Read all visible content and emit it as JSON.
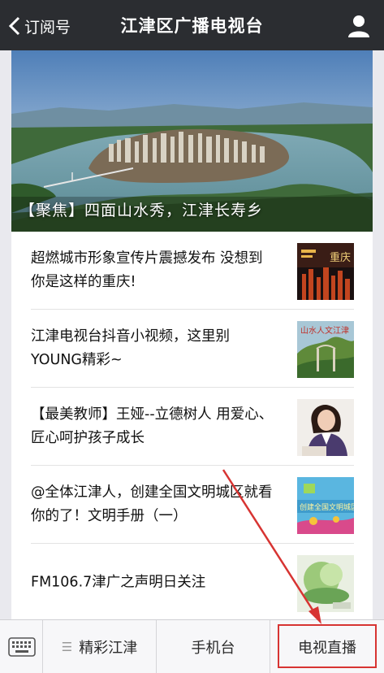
{
  "header": {
    "back_label": "订阅号",
    "title": "江津区广播电视台"
  },
  "hero": {
    "caption": "【聚焦】四面山水秀，江津长寿乡"
  },
  "articles": [
    {
      "title": "超燃城市形象宣传片震撼发布 没想到你是这样的重庆!"
    },
    {
      "title": "江津电视台抖音小视频，这里别YOUNG精彩~"
    },
    {
      "title": "【最美教师】王娅--立德树人 用爱心、匠心呵护孩子成长"
    },
    {
      "title": "@全体江津人，创建全国文明城区就看你的了！文明手册（一）"
    },
    {
      "title": "FM106.7津广之声明日关注"
    }
  ],
  "thumbs": {
    "t1_text": "重庆",
    "t2_text": "山水人文江津",
    "t4_text": "创建全国文明城区"
  },
  "tabbar": {
    "tabs": [
      "精彩江津",
      "手机台",
      "电视直播"
    ]
  },
  "colors": {
    "header_bg": "#2b2d31",
    "highlight": "#d73432"
  }
}
